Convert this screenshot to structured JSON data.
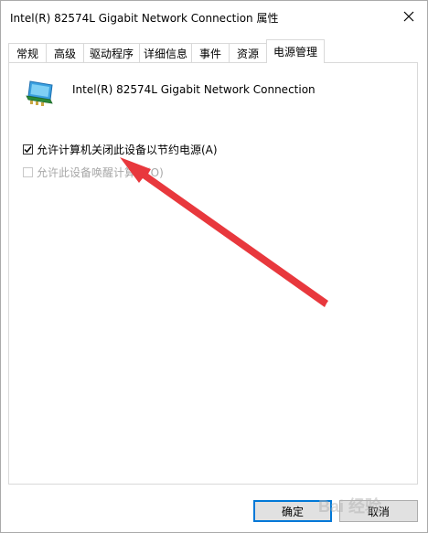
{
  "window": {
    "title": "Intel(R) 82574L Gigabit Network Connection 属性"
  },
  "tabs": [
    {
      "label": "常规"
    },
    {
      "label": "高级"
    },
    {
      "label": "驱动程序"
    },
    {
      "label": "详细信息"
    },
    {
      "label": "事件"
    },
    {
      "label": "资源"
    },
    {
      "label": "电源管理",
      "active": true
    }
  ],
  "device": {
    "name": "Intel(R) 82574L Gigabit Network Connection",
    "icon": "network-adapter-icon"
  },
  "options": [
    {
      "label": "允许计算机关闭此设备以节约电源(A)",
      "checked": true,
      "enabled": true
    },
    {
      "label": "允许此设备唤醒计算机(O)",
      "checked": false,
      "enabled": false
    }
  ],
  "buttons": {
    "ok": "确定",
    "cancel": "取消"
  },
  "watermark": "Bai 经验",
  "colors": {
    "annotation_arrow": "#e8383d",
    "default_button_border": "#0078d7"
  }
}
